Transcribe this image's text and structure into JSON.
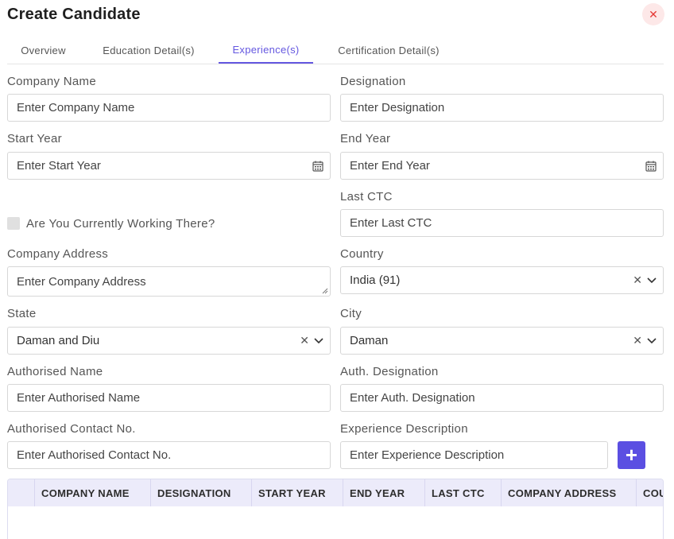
{
  "modal": {
    "title": "Create Candidate",
    "close_icon": "close-icon"
  },
  "tabs": [
    {
      "label": "Overview",
      "active": false
    },
    {
      "label": "Education Detail(s)",
      "active": false
    },
    {
      "label": "Experience(s)",
      "active": true
    },
    {
      "label": "Certification Detail(s)",
      "active": false
    }
  ],
  "form": {
    "company_name": {
      "label": "Company Name",
      "placeholder": "Enter Company Name"
    },
    "designation": {
      "label": "Designation",
      "placeholder": "Enter Designation"
    },
    "start_year": {
      "label": "Start Year",
      "placeholder": "Enter Start Year"
    },
    "end_year": {
      "label": "End Year",
      "placeholder": "Enter End Year"
    },
    "last_ctc": {
      "label": "Last CTC",
      "placeholder": "Enter Last CTC"
    },
    "currently_working": {
      "label": "Are You Currently Working There?",
      "checked": false
    },
    "company_address": {
      "label": "Company Address",
      "placeholder": "Enter Company Address"
    },
    "country": {
      "label": "Country",
      "value": "India (91)"
    },
    "state": {
      "label": "State",
      "value": "Daman and Diu"
    },
    "city": {
      "label": "City",
      "value": "Daman"
    },
    "authorised_name": {
      "label": "Authorised Name",
      "placeholder": "Enter Authorised Name"
    },
    "auth_designation": {
      "label": "Auth. Designation",
      "placeholder": "Enter Auth. Designation"
    },
    "authorised_contact": {
      "label": "Authorised Contact No.",
      "placeholder": "Enter Authorised Contact No."
    },
    "experience_description": {
      "label": "Experience Description",
      "placeholder": "Enter Experience Description"
    },
    "add_button_label": "+"
  },
  "table": {
    "columns": [
      "COMPANY NAME",
      "DESIGNATION",
      "START YEAR",
      "END YEAR",
      "LAST CTC",
      "COMPANY ADDRESS",
      "COU"
    ]
  },
  "colors": {
    "accent": "#6457e0",
    "add_button": "#5b4fe2",
    "close": "#e53935",
    "table_header_bg": "#ecebfa"
  }
}
